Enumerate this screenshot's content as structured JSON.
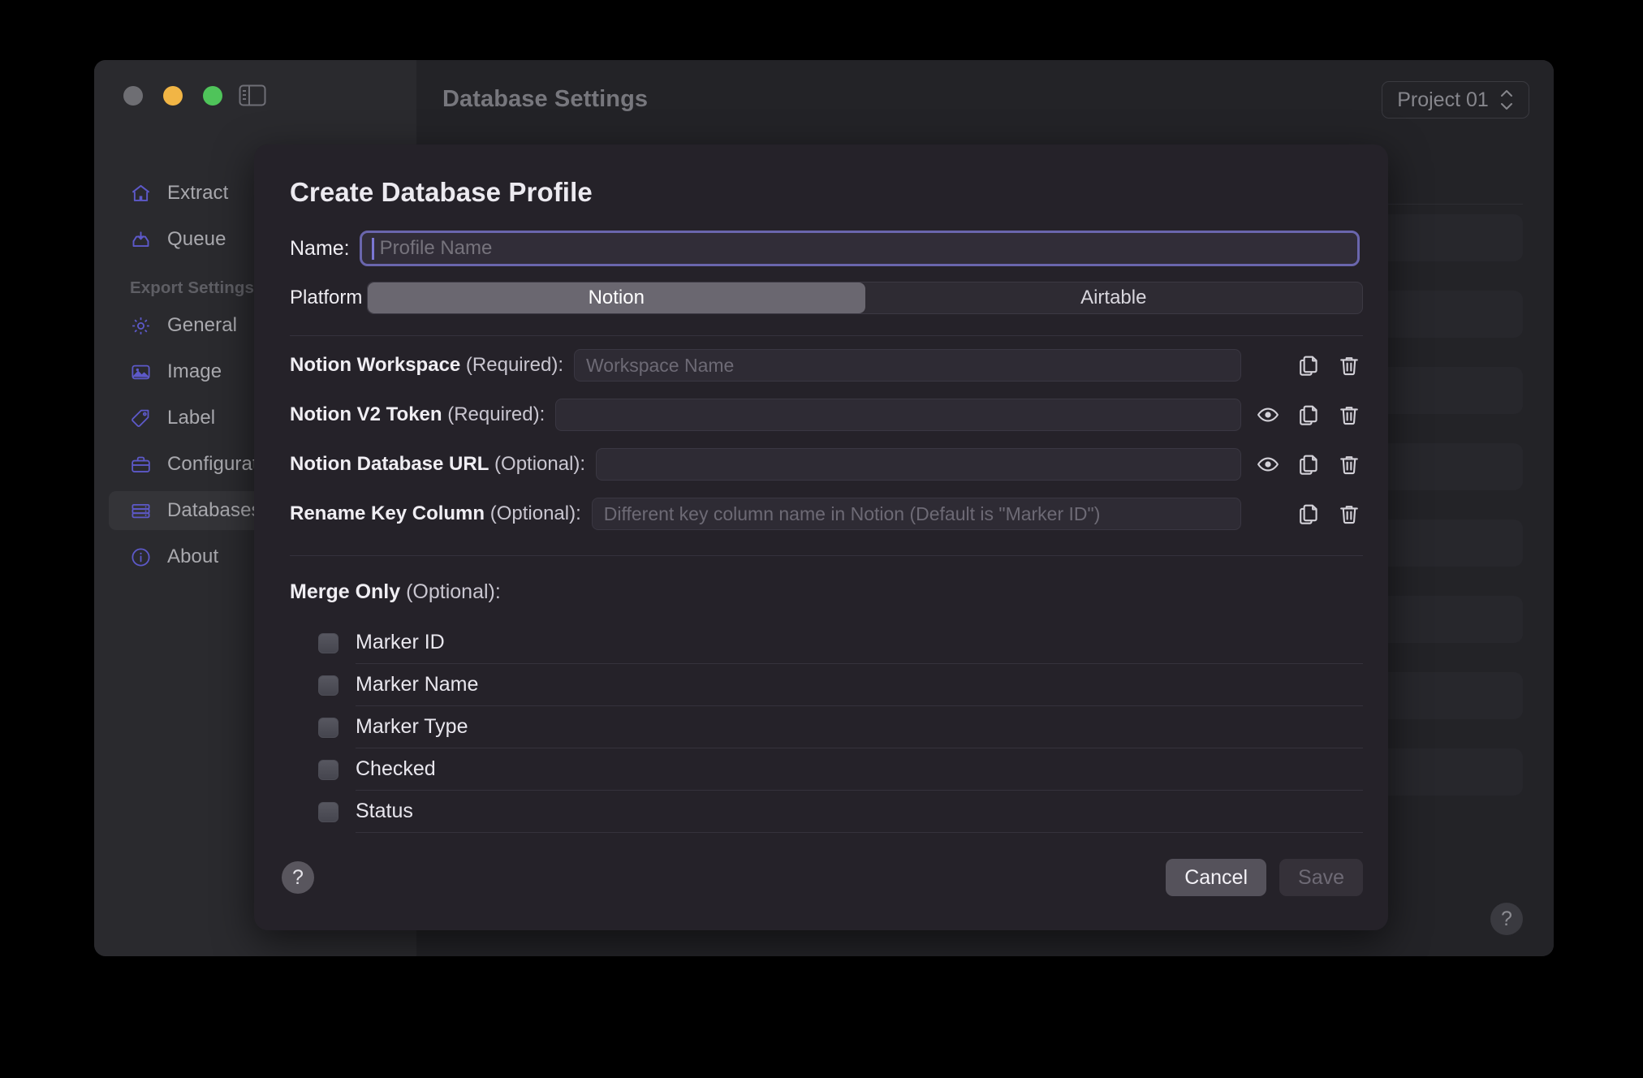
{
  "window": {
    "traffic_lights": [
      "close",
      "minimize",
      "maximize"
    ],
    "sidebar_toggle_icon": "sidebar-toggle-icon"
  },
  "sidebar": {
    "items": [
      {
        "label": "Extract",
        "icon": "home-icon",
        "selected": false
      },
      {
        "label": "Queue",
        "icon": "upload-tray-icon",
        "selected": false
      }
    ],
    "group_title": "Export Settings",
    "group_items": [
      {
        "label": "General",
        "icon": "gear-icon",
        "selected": false
      },
      {
        "label": "Image",
        "icon": "image-icon",
        "selected": false
      },
      {
        "label": "Label",
        "icon": "tag-icon",
        "selected": false
      },
      {
        "label": "Configuration",
        "icon": "briefcase-icon",
        "selected": false
      },
      {
        "label": "Databases",
        "icon": "database-icon",
        "selected": true
      },
      {
        "label": "About",
        "icon": "info-icon",
        "selected": false
      }
    ]
  },
  "header": {
    "title": "Database Settings",
    "project_selector": {
      "value": "Project 01",
      "icon": "stepper-chevrons-icon"
    },
    "help_label": "?"
  },
  "modal": {
    "title": "Create Database Profile",
    "name": {
      "label": "Name:",
      "value": "",
      "placeholder": "Profile Name"
    },
    "platform": {
      "label": "Platform",
      "options": [
        "Notion",
        "Airtable"
      ],
      "selected": "Notion"
    },
    "fields": [
      {
        "label_bold": "Notion Workspace",
        "label_opt": " (Required):",
        "value": "",
        "placeholder": "Workspace Name",
        "has_eye": false,
        "copy_icon": "copy-icon",
        "delete_icon": "trash-icon"
      },
      {
        "label_bold": "Notion V2 Token",
        "label_opt": " (Required):",
        "value": "",
        "placeholder": "",
        "has_eye": true,
        "eye_icon": "eye-icon",
        "copy_icon": "copy-icon",
        "delete_icon": "trash-icon"
      },
      {
        "label_bold": "Notion Database URL",
        "label_opt": " (Optional):",
        "value": "",
        "placeholder": "",
        "has_eye": true,
        "eye_icon": "eye-icon",
        "copy_icon": "copy-icon",
        "delete_icon": "trash-icon"
      },
      {
        "label_bold": "Rename Key Column",
        "label_opt": " (Optional):",
        "value": "",
        "placeholder": "Different key column name in Notion (Default is \"Marker ID\")",
        "has_eye": false,
        "copy_icon": "copy-icon",
        "delete_icon": "trash-icon"
      }
    ],
    "merge_only": {
      "label_bold": "Merge Only",
      "label_opt": " (Optional):",
      "items": [
        {
          "label": "Marker ID",
          "checked": false
        },
        {
          "label": "Marker Name",
          "checked": false
        },
        {
          "label": "Marker Type",
          "checked": false
        },
        {
          "label": "Checked",
          "checked": false
        },
        {
          "label": "Status",
          "checked": false
        }
      ]
    },
    "footer": {
      "help_label": "?",
      "cancel_label": "Cancel",
      "save_label": "Save",
      "save_disabled": true
    }
  },
  "colors": {
    "accent": "#6a66ad",
    "modal_bg": "#252229",
    "window_bg": "#232327",
    "sidebar_bg": "#2a2a2e",
    "icon_purple": "#5d59c9"
  }
}
